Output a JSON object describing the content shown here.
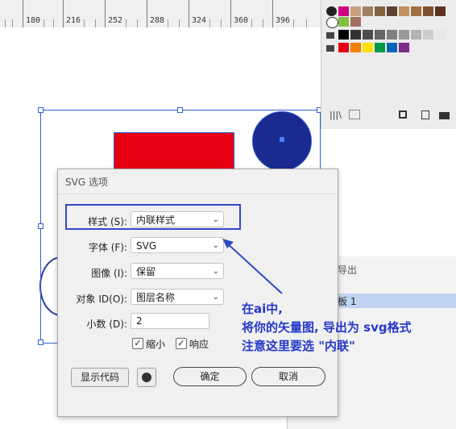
{
  "ruler": {
    "labels": [
      "180",
      "216",
      "252",
      "288",
      "324",
      "360",
      "396"
    ]
  },
  "dialog": {
    "title": "SVG 选项",
    "fields": {
      "style_label": "样式 (S):",
      "style_value": "内联样式",
      "font_label": "字体 (F):",
      "font_value": "SVG",
      "image_label": "图像 (I):",
      "image_value": "保留",
      "objid_label": "对象 ID(O):",
      "objid_value": "图层名称",
      "decimal_label": "小数 (D):",
      "decimal_value": "2"
    },
    "checkboxes": {
      "minify_label": "缩小",
      "minify_checked": true,
      "responsive_label": "响应",
      "responsive_checked": true
    },
    "buttons": {
      "show_code": "显示代码",
      "ok": "确定",
      "cancel": "取消"
    }
  },
  "layers_panel": {
    "tab_label": "源导出",
    "row_label": "板 1"
  },
  "annotation": {
    "line1": "在ai中,",
    "line2": "将你的矢量图, 导出为 svg格式",
    "line3": "注意这里要选 \"内联\""
  },
  "colors": {
    "accent": "#2438c8",
    "selection": "#2f5fd0",
    "red_rect": "#e60012",
    "navy_circle": "#1a2a8f",
    "highlight_box": "#3049c8",
    "swatches_row3": [
      "#e60012",
      "#f08000",
      "#ffe100",
      "#009944",
      "#0068b7",
      "#7d2a8a"
    ]
  },
  "icons": [
    "world-icon",
    "chevron-down-icon",
    "check-icon",
    "folder-icon",
    "library-icon",
    "trash-icon"
  ]
}
